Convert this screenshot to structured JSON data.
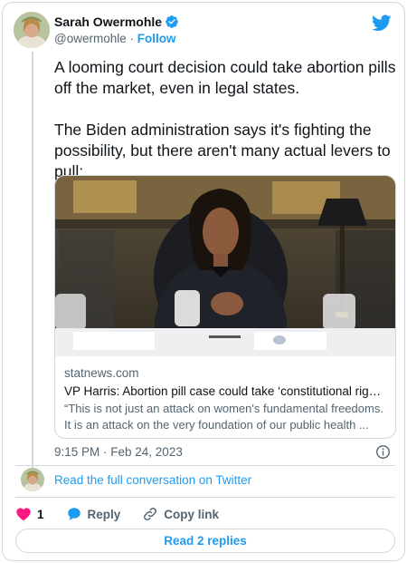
{
  "author": {
    "name": "Sarah Owermohle",
    "handle": "@owermohle",
    "separator": "·",
    "follow_label": "Follow"
  },
  "tweet": {
    "text": "A looming court decision could take abortion pills off the market, even in legal states.\n\nThe Biden administration says it's fighting the possibility, but there aren't many actual levers to pull:",
    "timestamp": "9:15 PM · Feb 24, 2023"
  },
  "link_card": {
    "domain": "statnews.com",
    "title": "VP Harris: Abortion pill case could take ‘constitutional right’ f...",
    "description": "“This is not just an attack on women's fundamental freedoms. It is an attack on the very foundation of our public health ..."
  },
  "conversation": {
    "link_label": "Read the full conversation on Twitter"
  },
  "actions": {
    "like_count": "1",
    "reply_label": "Reply",
    "copy_label": "Copy link"
  },
  "replies_button": {
    "label": "Read 2 replies"
  },
  "colors": {
    "accent": "#1d9bf0",
    "like": "#f91880",
    "border": "#cfd9de",
    "muted": "#536471"
  },
  "icons": [
    "verified-badge-icon",
    "twitter-bird-icon",
    "info-icon",
    "heart-icon",
    "reply-bubble-icon",
    "link-icon"
  ]
}
